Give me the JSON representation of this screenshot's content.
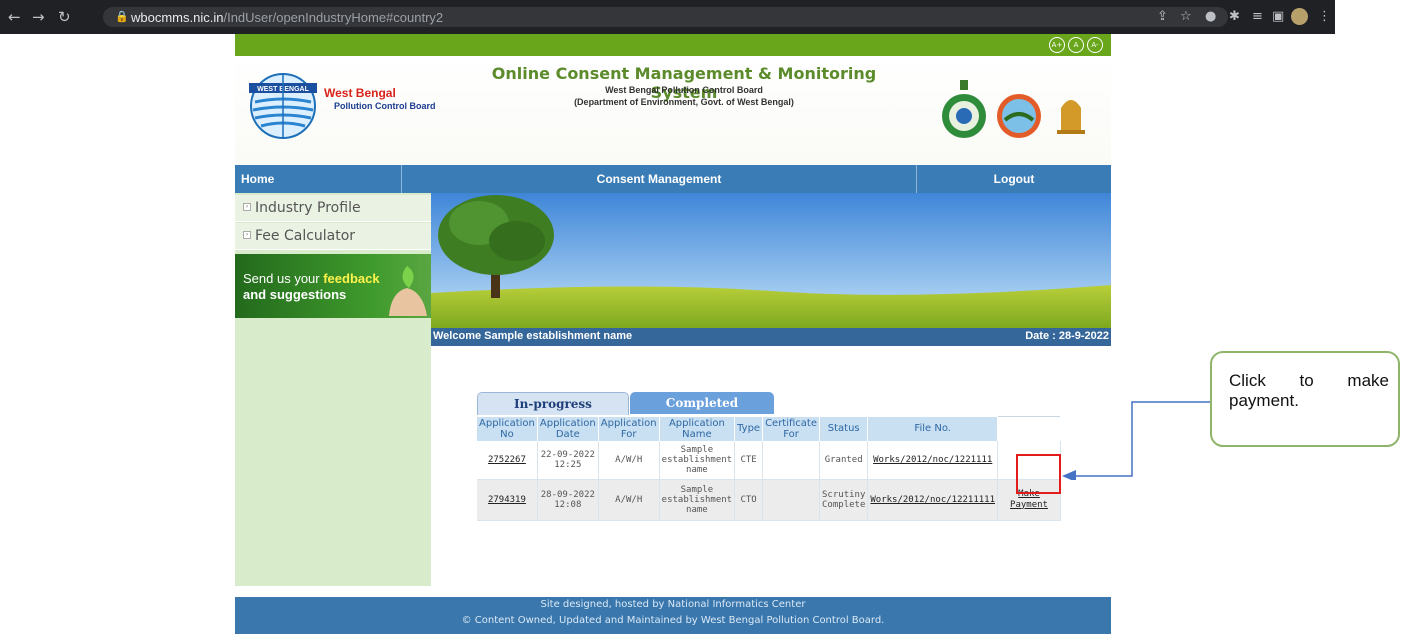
{
  "browser": {
    "url_host": "wbocmms.nic.in",
    "url_path": "/IndUser/openIndustryHome#country2"
  },
  "header": {
    "logo_title": "West Bengal",
    "logo_subtitle": "Pollution Control Board",
    "logo_badge": "WEST BENGAL",
    "title": "Online Consent Management & Monitoring System",
    "subtitle1": "West Bengal Pollution Control Board",
    "subtitle2": "(Department of Environment, Govt. of West Bengal)",
    "access_buttons": [
      "A+",
      "A",
      "A-"
    ]
  },
  "menu": {
    "home": "Home",
    "consent": "Consent Management",
    "logout": "Logout"
  },
  "sidebar": {
    "items": [
      {
        "label": "Industry Profile"
      },
      {
        "label": "Fee Calculator"
      }
    ],
    "feedback_line1_a": "Send us your ",
    "feedback_line1_b": "feedback",
    "feedback_line2": "and suggestions"
  },
  "welcome": {
    "text": "Welcome Sample establishment name",
    "date": "Date : 28-9-2022"
  },
  "tabs": {
    "in_progress": "In-progress Application",
    "completed": "Completed Application"
  },
  "table": {
    "headers": [
      "Application No",
      "Application Date",
      "Application For",
      "Application Name",
      "Type",
      "Certificate For",
      "Status",
      "File No."
    ],
    "rows": [
      {
        "no": "2752267",
        "date1": "22-09-2022",
        "date2": "12:25",
        "for": "A/W/H",
        "name": "Sample establishment name",
        "type": "CTE",
        "cert": "",
        "status": "Granted",
        "file": "Works/2012/noc/1221111",
        "action1": "",
        "action2": ""
      },
      {
        "no": "2794319",
        "date1": "28-09-2022",
        "date2": "12:08",
        "for": "A/W/H",
        "name": "Sample establishment name",
        "type": "CTO",
        "cert": "",
        "status": "Scrutiny Complete",
        "file": "Works/2012/noc/12211111",
        "action1": "Make",
        "action2": "Payment"
      }
    ]
  },
  "footer": {
    "line1": "Site designed, hosted by National Informatics Center",
    "line2": "© Content Owned, Updated and Maintained by West Bengal Pollution Control Board."
  },
  "annotation": {
    "callout_text": "Click to make payment."
  },
  "colors": {
    "menu_blue": "#3a7cb5",
    "accent_green": "#6aa61c",
    "highlight_red": "#e31b1b"
  }
}
